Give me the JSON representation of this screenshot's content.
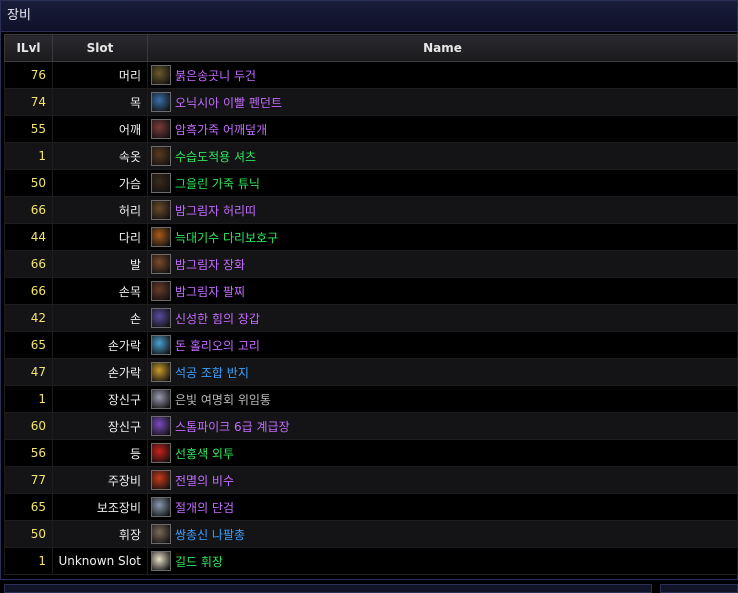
{
  "panel": {
    "title": "장비"
  },
  "table": {
    "headers": {
      "ilvl": "ILvl",
      "slot": "Slot",
      "name": "Name"
    },
    "rows": [
      {
        "ilvl": "76",
        "slot": "머리",
        "name": "붉은송곳니 두건",
        "quality": "epic",
        "icon": "helmet-icon",
        "color": "#6b5a2a"
      },
      {
        "ilvl": "74",
        "slot": "목",
        "name": "오닉시아 이빨 펜던트",
        "quality": "epic",
        "icon": "pendant-icon",
        "color": "#3a6ea8"
      },
      {
        "ilvl": "55",
        "slot": "어깨",
        "name": "암흑가죽 어깨덮개",
        "quality": "epic",
        "icon": "shoulder-icon",
        "color": "#7a3a3a"
      },
      {
        "ilvl": "1",
        "slot": "속옷",
        "name": "수습도적용 셔츠",
        "quality": "uncommon",
        "icon": "shirt-icon",
        "color": "#5a3a22"
      },
      {
        "ilvl": "50",
        "slot": "가슴",
        "name": "그을린 가죽 튜닉",
        "quality": "uncommon",
        "icon": "tunic-icon",
        "color": "#3a2a1c"
      },
      {
        "ilvl": "66",
        "slot": "허리",
        "name": "밤그림자 허리띠",
        "quality": "epic",
        "icon": "belt-icon",
        "color": "#6a4a2a"
      },
      {
        "ilvl": "44",
        "slot": "다리",
        "name": "늑대기수 다리보호구",
        "quality": "uncommon",
        "icon": "legs-icon",
        "color": "#a85a1a"
      },
      {
        "ilvl": "66",
        "slot": "발",
        "name": "밤그림자 장화",
        "quality": "epic",
        "icon": "boots-icon",
        "color": "#7a4a2a"
      },
      {
        "ilvl": "66",
        "slot": "손목",
        "name": "밤그림자 팔찌",
        "quality": "epic",
        "icon": "bracer-icon",
        "color": "#6a3a2a"
      },
      {
        "ilvl": "42",
        "slot": "손",
        "name": "신성한 힘의 장갑",
        "quality": "epic",
        "icon": "gloves-icon",
        "color": "#5a4aa0"
      },
      {
        "ilvl": "65",
        "slot": "손가락",
        "name": "돈 홀리오의 고리",
        "quality": "epic",
        "icon": "ring-icon",
        "color": "#4aa0d0"
      },
      {
        "ilvl": "47",
        "slot": "손가락",
        "name": "석공 조합 반지",
        "quality": "rare",
        "icon": "gold-ring-icon",
        "color": "#c89a2a"
      },
      {
        "ilvl": "1",
        "slot": "장신구",
        "name": "은빛 여명회 위임통",
        "quality": "common",
        "icon": "trinket-icon",
        "color": "#9a9ab0"
      },
      {
        "ilvl": "60",
        "slot": "장신구",
        "name": "스톰파이크 6급 계급장",
        "quality": "epic",
        "icon": "insignia-icon",
        "color": "#7a4ac0"
      },
      {
        "ilvl": "56",
        "slot": "등",
        "name": "선홍색 외투",
        "quality": "uncommon",
        "icon": "cloak-icon",
        "color": "#c8201a"
      },
      {
        "ilvl": "77",
        "slot": "주장비",
        "name": "전멸의 비수",
        "quality": "epic",
        "icon": "dagger-icon",
        "color": "#c83a1a"
      },
      {
        "ilvl": "65",
        "slot": "보조장비",
        "name": "절개의 단검",
        "quality": "epic",
        "icon": "offhand-dagger-icon",
        "color": "#8a9ab0"
      },
      {
        "ilvl": "50",
        "slot": "휘장",
        "name": "쌍총신 나팔총",
        "quality": "rare",
        "icon": "gun-icon",
        "color": "#7a6a5a"
      },
      {
        "ilvl": "1",
        "slot": "Unknown Slot",
        "name": "길드 휘장",
        "quality": "uncommon",
        "icon": "tabard-icon",
        "color": "#e8e0c8"
      }
    ]
  }
}
